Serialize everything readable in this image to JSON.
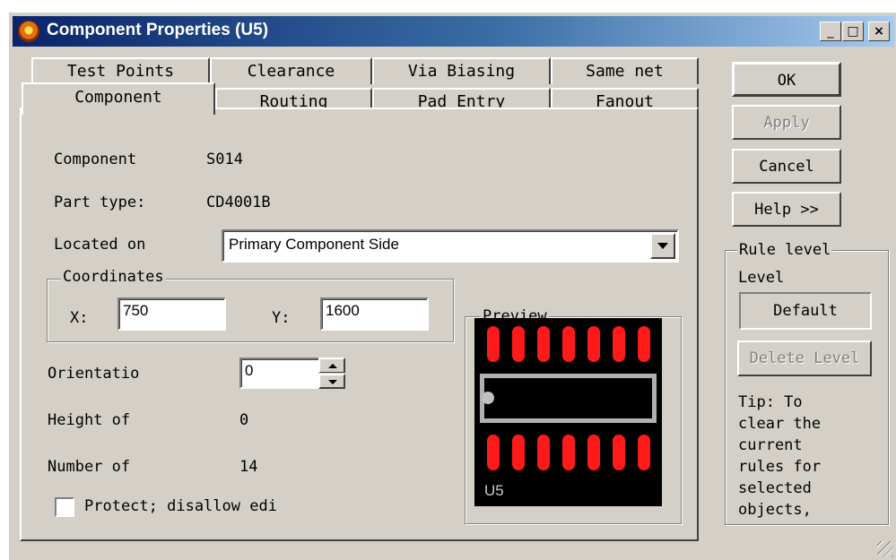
{
  "dialog": {
    "title": "Component Properties (U5)"
  },
  "tabs": {
    "row1": [
      "Test Points",
      "Clearance",
      "Via Biasing",
      "Same net"
    ],
    "row2": [
      "Component",
      "Routing",
      "Pad Entry",
      "Fanout"
    ]
  },
  "component": {
    "component_label": "Component",
    "component_value": "S014",
    "part_type_label": "Part type:",
    "part_type_value": "CD4001B",
    "located_on_label": "Located on",
    "located_on_value": "Primary Component Side",
    "coordinates_title": "Coordinates",
    "x_label": "X:",
    "x_value": "750",
    "y_label": "Y:",
    "y_value": "1600",
    "orientation_label": "Orientatio",
    "orientation_value": "0",
    "height_label": "Height of",
    "height_value": "0",
    "number_label": "Number of",
    "number_value": "14",
    "protect_label": "Protect; disallow edi",
    "protect_checked": false
  },
  "preview": {
    "title": "Preview",
    "refdes": "U5",
    "pad_color": "#ff1a1a",
    "body_color": "#000000"
  },
  "buttons": {
    "ok": "OK",
    "apply": "Apply",
    "cancel": "Cancel",
    "help": "Help >>"
  },
  "rule_level": {
    "title": "Rule level",
    "level_label": "Level",
    "level_value": "Default",
    "delete_button": "Delete Level",
    "tip_lines": [
      "Tip: To",
      "clear the",
      "current",
      "rules for",
      "selected",
      "objects,"
    ]
  }
}
